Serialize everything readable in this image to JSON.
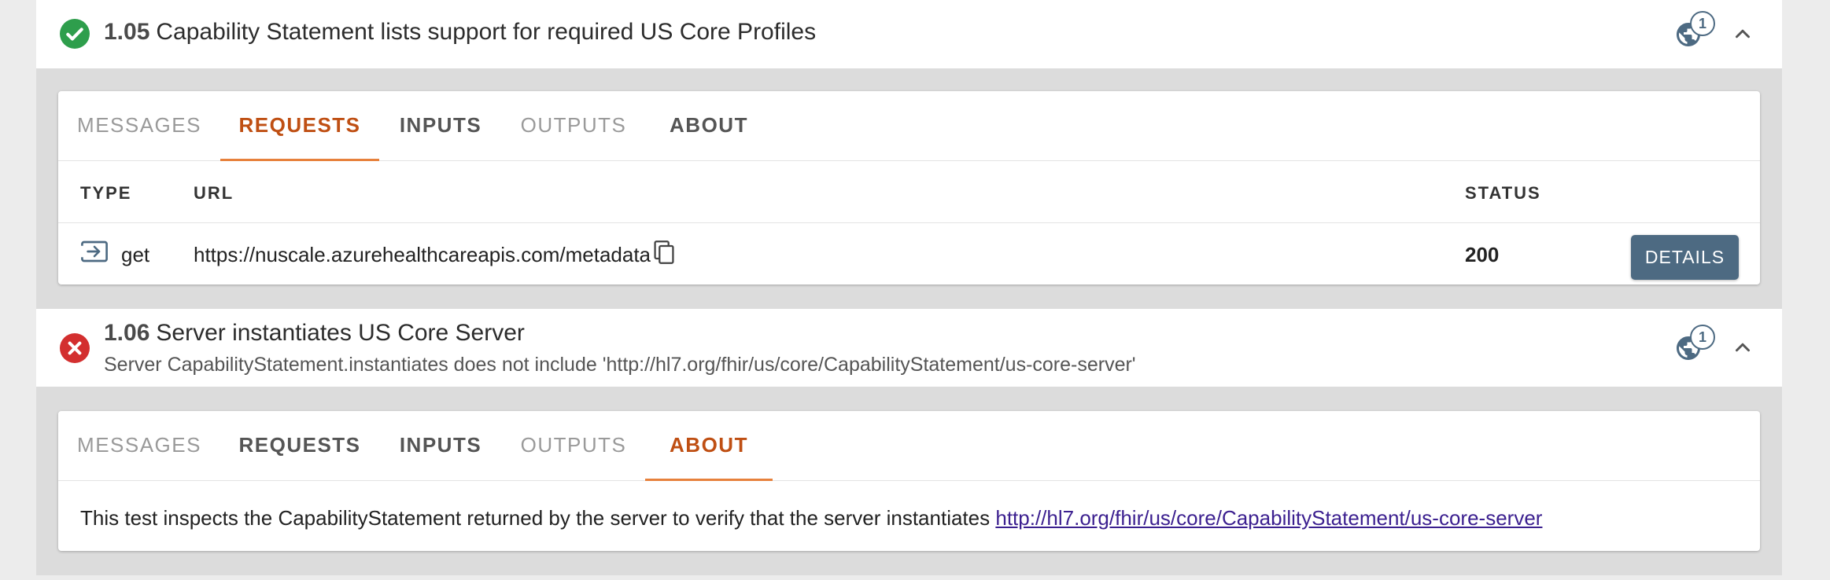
{
  "tests": [
    {
      "number": "1.05",
      "title": "Capability Statement lists support for required US Core Profiles",
      "status": "pass",
      "request_count": "1",
      "tabs": [
        "MESSAGES",
        "REQUESTS",
        "INPUTS",
        "OUTPUTS",
        "ABOUT"
      ],
      "active_tab": "REQUESTS",
      "table": {
        "headers": {
          "type": "TYPE",
          "url": "URL",
          "status": "STATUS"
        },
        "rows": [
          {
            "verb": "get",
            "url": "https://nuscale.azurehealthcareapis.com/metadata",
            "status": "200",
            "details_label": "DETAILS"
          }
        ]
      }
    },
    {
      "number": "1.06",
      "title": "Server instantiates US Core Server",
      "subtitle": "Server CapabilityStatement.instantiates does not include 'http://hl7.org/fhir/us/core/CapabilityStatement/us-core-server'",
      "status": "fail",
      "request_count": "1",
      "tabs": [
        "MESSAGES",
        "REQUESTS",
        "INPUTS",
        "OUTPUTS",
        "ABOUT"
      ],
      "active_tab": "ABOUT",
      "about": {
        "text": "This test inspects the CapabilityStatement returned by the server to verify that the server instantiates",
        "link": "http://hl7.org/fhir/us/core/CapabilityStatement/us-core-server"
      }
    }
  ],
  "icons": {
    "pass": "check-circle-icon",
    "fail": "error-circle-icon",
    "requests": "public-globe-icon",
    "collapse": "chevron-up-icon",
    "request_row": "input-arrow-icon",
    "copy": "copy-icon"
  },
  "colors": {
    "pass": "#2e9e4c",
    "fail": "#d32f2f",
    "accent_tab": "#bf4f13",
    "tab_underline": "#e7813c",
    "primary_button": "#4d6a82",
    "link": "#3b1f8f"
  }
}
